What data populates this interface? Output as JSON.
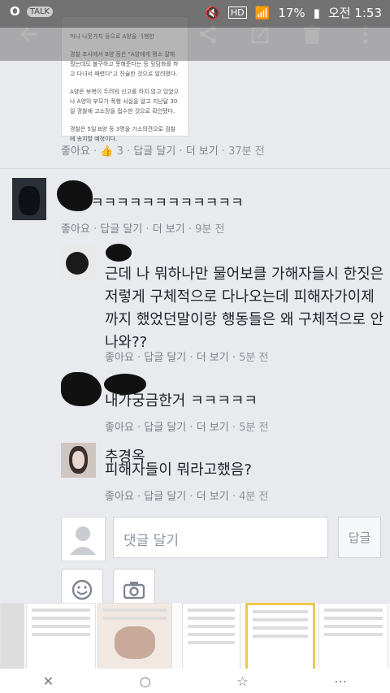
{
  "status_bar": {
    "battery": "17%",
    "time": "오전 1:53",
    "hd_label": "HD",
    "talk_label": "TALK"
  },
  "action_bar": {
    "icons": [
      "back-arrow-icon",
      "screen-icon",
      "share-icon",
      "edit-icon",
      "delete-icon",
      "more-icon"
    ]
  },
  "article": {
    "line1": "미나 나뭇가지 등으로 A양을 폭행한",
    "para2": "경찰 조사에서 B양 등은 \"A양에게 평소 잘해줬는데도 불구하고 못해준다는 등 뒷담화를 하고 다녀서 때렸다\"고 진술한 것으로 알려졌다.",
    "para3": "A양은 보복이 두려워 신고를 하지 않고 있었으나 A양의 부모가 폭행 사실을 알고 지난달 30일 경찰에 고소장을 접수한 것으로 확인됐다.",
    "para4": "경찰은 5일 B양 등 3명을 기소의견으로 검찰에 송치할 예정이다."
  },
  "post_meta": {
    "like": "좋아요",
    "like_count": "3",
    "reply": "답글 달기",
    "more": "더 보기",
    "time": "37분 전"
  },
  "comments": [
    {
      "text": "ㅋㅋㅋㅋㅋㅋㅋㅋㅋㅋㅋㅋ",
      "like": "좋아요",
      "reply": "답글 달기",
      "more": "더 보기",
      "time": "9분 전"
    },
    {
      "text_lines": [
        "근데 나 뭐하나만 물어보클 가해자들시 한짓은",
        "저렇게 구체적으로 다나오는데 피해자가이제",
        "까지 했었던말이랑 행동들은 왜 구체적으로 안",
        "나와??"
      ],
      "like": "좋아요",
      "reply": "답글 달기",
      "more": "더 보기",
      "time": "5분 전"
    },
    {
      "text": "내가궁금한거 ㅋㅋㅋㅋㅋ",
      "like": "좋아요",
      "reply": "답글 달기",
      "more": "더 보기",
      "time": "5분 전"
    },
    {
      "name": "추경옥",
      "text": "피해자들이 뭐라고했음?",
      "like": "좋아요",
      "reply": "답글 달기",
      "more": "더 보기",
      "time": "4분 전"
    }
  ],
  "composer": {
    "placeholder": "댓글 달기",
    "submit": "답글"
  },
  "colors": {
    "background": "#e9eaed",
    "meta_text": "#90949c",
    "text": "#1d2129"
  }
}
